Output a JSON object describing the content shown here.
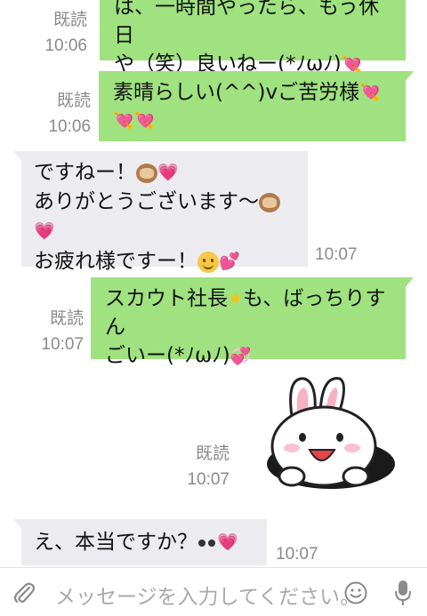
{
  "messages": {
    "m1": {
      "read": "既読",
      "time": "10:06",
      "line1": "は、一時間やったら、もう休日",
      "line2": "や（笑）良いねー(*ﾉωﾉ)",
      "emoji": "💘"
    },
    "m2": {
      "read": "既読",
      "time": "10:06",
      "line1": "素晴らしい(^^)vご苦労様",
      "emoji1": "💘",
      "emoji2": "💘💘"
    },
    "m3": {
      "line1": "ですねー！",
      "line2": "ありがとうございます〜",
      "line3": "お疲れ様ですー！",
      "heart": "💗",
      "hearts2": "💕",
      "time": "10:07"
    },
    "m4": {
      "read": "既読",
      "time": "10:07",
      "line1a": "スカウト社長",
      "star": "★",
      "line1b": "も、ばっちりすん",
      "line2": "ごいー(*ﾉωﾉ)",
      "sparkle": "💞"
    },
    "m5": {
      "read": "既読",
      "time": "10:07"
    },
    "m6": {
      "text": "え、本当ですか？",
      "heart": "💗",
      "time": "10:07"
    }
  },
  "input": {
    "placeholder": "メッセージを入力してください。"
  },
  "colors": {
    "outgoing_bubble": "#9fe27f",
    "incoming_bubble": "#ececf0",
    "meta_text": "#8a8a8a"
  },
  "icons": [
    "paperclip-icon",
    "emoji-icon",
    "microphone-icon",
    "heart-arrow-icon",
    "monkey-icon",
    "smile-icon",
    "star-icon",
    "eyes-icon",
    "bunny-sticker"
  ]
}
